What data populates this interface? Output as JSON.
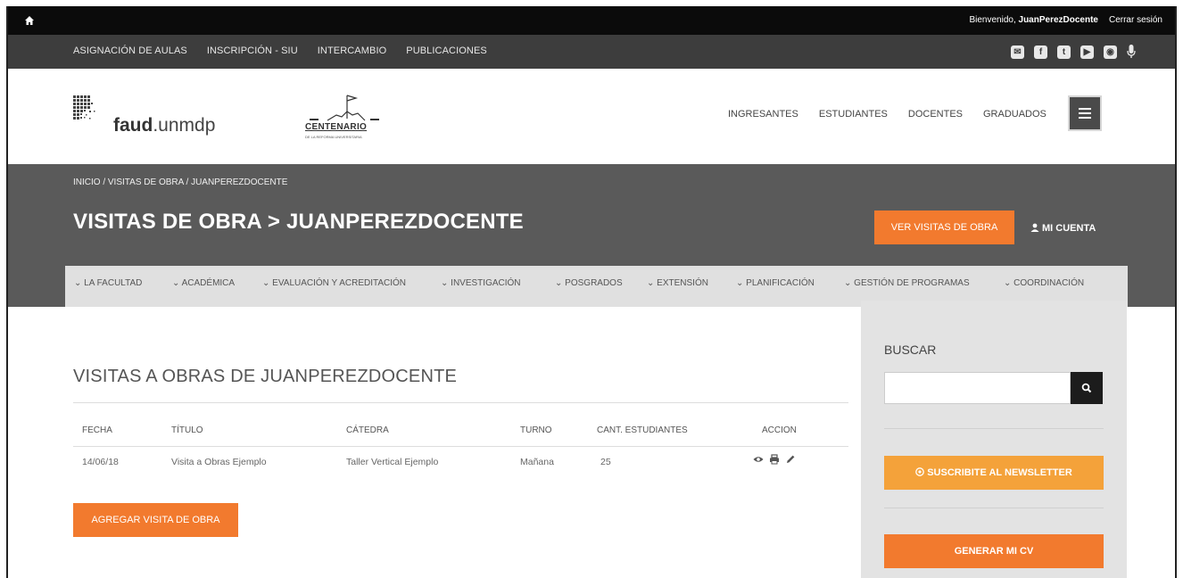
{
  "topbar": {
    "welcome_prefix": "Bienvenido,",
    "username": "JuanPerezDocente",
    "logout": "Cerrar sesión"
  },
  "topnav": [
    "ASIGNACIÓN DE AULAS",
    "INSCRIPCIÓN - SIU",
    "INTERCAMBIO",
    "PUBLICACIONES"
  ],
  "socials": [
    {
      "name": "mail-icon",
      "glyph": "✉"
    },
    {
      "name": "facebook-icon",
      "glyph": "f"
    },
    {
      "name": "twitter-icon",
      "glyph": "t"
    },
    {
      "name": "youtube-icon",
      "glyph": "▶"
    },
    {
      "name": "instagram-icon",
      "glyph": "◉"
    }
  ],
  "header": {
    "logo_bold": "faud",
    "logo_rest": ".unmdp",
    "centenario": "CENTENARIO",
    "centenario_sub": "DE LA REFORMA UNIVERSITARIA",
    "links": [
      "INGRESANTES",
      "ESTUDIANTES",
      "DOCENTES",
      "GRADUADOS"
    ]
  },
  "band": {
    "breadcrumb": "INICIO / VISITAS DE OBRA / JUANPEREZDOCENTE",
    "title": "VISITAS DE OBRA > JUANPEREZDOCENTE",
    "ver_button": "VER VISITAS DE OBRA",
    "mi_cuenta": "MI CUENTA"
  },
  "menu": [
    "LA FACULTAD",
    "ACADÉMICA",
    "EVALUACIÓN Y ACREDITACIÓN",
    "INVESTIGACIÓN",
    "POSGRADOS",
    "EXTENSIÓN",
    "PLANIFICACIÓN",
    "GESTIÓN DE PROGRAMAS",
    "COORDINACIÓN"
  ],
  "main": {
    "section_title": "VISITAS A OBRAS DE JUANPEREZDOCENTE",
    "columns": [
      "FECHA",
      "TÍTULO",
      "CÁTEDRA",
      "TURNO",
      "CANT. ESTUDIANTES",
      "ACCION"
    ],
    "rows": [
      {
        "fecha": "14/06/18",
        "titulo": "Visita a Obras Ejemplo",
        "catedra": "Taller Vertical Ejemplo",
        "turno": "Mañana",
        "cant": "25"
      }
    ],
    "add_button": "AGREGAR VISITA DE OBRA"
  },
  "sidebar": {
    "buscar": "BUSCAR",
    "search_value": "",
    "newsletter": "SUSCRIBITE AL NEWSLETTER",
    "cv": "GENERAR MI CV"
  },
  "colors": {
    "orange": "#f27a2e",
    "dark": "#3d3d3d",
    "band": "#5a5a5a"
  }
}
